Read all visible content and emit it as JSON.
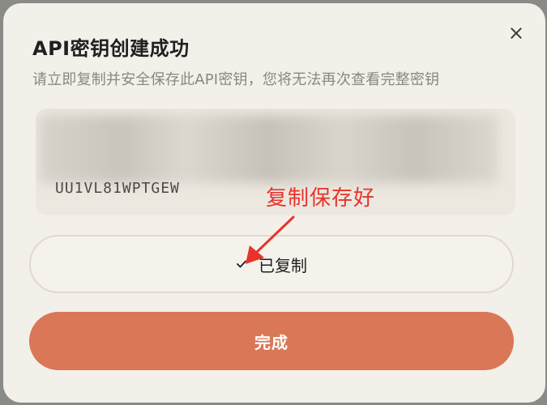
{
  "dialog": {
    "title": "API密钥创建成功",
    "subtitle": "请立即复制并安全保存此API密钥，您将无法再次查看完整密钥",
    "key_visible_tail": "UU1VL81WPTGEW",
    "copied_label": "已复制",
    "done_label": "完成"
  },
  "annotation": {
    "text": "复制保存好",
    "color": "#e8332a"
  },
  "colors": {
    "primary": "#d97757",
    "background": "#f3f0ea"
  },
  "icons": {
    "close": "close-icon",
    "check": "check-icon"
  }
}
